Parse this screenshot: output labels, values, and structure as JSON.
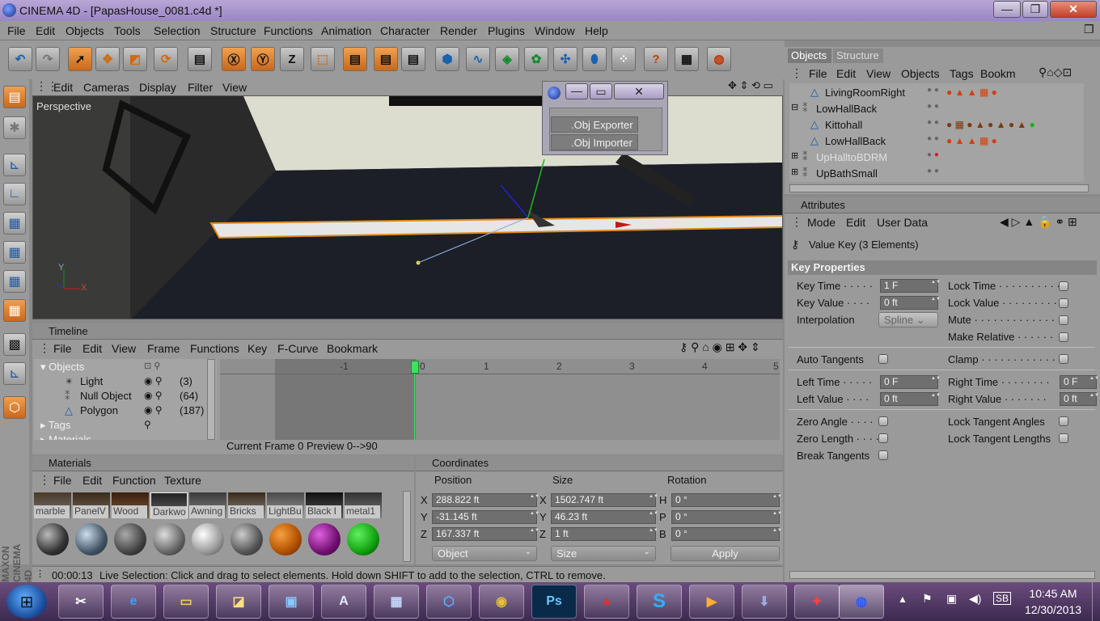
{
  "window": {
    "title": "CINEMA 4D - [PapasHouse_0081.c4d *]",
    "min": "—",
    "max": "❐",
    "close": "✕"
  },
  "menu": [
    "File",
    "Edit",
    "Objects",
    "Tools",
    "Selection",
    "Structure",
    "Functions",
    "Animation",
    "Character",
    "Render",
    "Plugins",
    "Window",
    "Help"
  ],
  "viewport": {
    "menu": [
      "Edit",
      "Cameras",
      "Display",
      "Filter",
      "View"
    ],
    "label": "Perspective",
    "axis_x": "X",
    "axis_y": "Y"
  },
  "popup": {
    "items": [
      ".Obj Exporter",
      ".Obj Importer"
    ]
  },
  "objects_panel": {
    "tabs": [
      "Objects",
      "Structure"
    ],
    "menu": [
      "File",
      "Edit",
      "View",
      "Objects",
      "Tags",
      "Bookm"
    ],
    "rows": [
      {
        "name": "LivingRoomRight"
      },
      {
        "name": "LowHallBack"
      },
      {
        "name": "Kittohall"
      },
      {
        "name": "LowHallBack"
      },
      {
        "name": "UpHalltoBDRM"
      },
      {
        "name": "UpBathSmall"
      }
    ]
  },
  "attributes": {
    "header": "Attributes",
    "menu": [
      "Mode",
      "Edit",
      "User Data"
    ],
    "title": "Value Key (3 Elements)",
    "section": "Key Properties",
    "key_time_label": "Key Time",
    "key_time": "1 F",
    "key_value_label": "Key Value",
    "key_value": "0 ft",
    "interpolation_label": "Interpolation",
    "interpolation": "Spline",
    "lock_time": "Lock Time",
    "lock_value": "Lock Value",
    "mute": "Mute",
    "make_relative": "Make Relative",
    "auto_tangents": "Auto Tangents",
    "clamp": "Clamp",
    "left_time_label": "Left Time",
    "left_time": "0 F",
    "left_value_label": "Left Value",
    "left_value": "0 ft",
    "right_time_label": "Right Time",
    "right_time": "0 F",
    "right_value_label": "Right Value",
    "right_value": "0 ft",
    "zero_angle": "Zero Angle",
    "zero_length": "Zero Length",
    "break_tangents": "Break Tangents",
    "lock_tangent_angles": "Lock Tangent Angles",
    "lock_tangent_lengths": "Lock Tangent Lengths"
  },
  "timeline": {
    "title": "Timeline",
    "menu": [
      "File",
      "Edit",
      "View",
      "Frame",
      "Functions",
      "Key",
      "F-Curve",
      "Bookmark"
    ],
    "tree": {
      "root": "Objects",
      "items": [
        {
          "name": "Light",
          "count": "(3)"
        },
        {
          "name": "Null Object",
          "count": "(64)"
        },
        {
          "name": "Polygon",
          "count": "(187)"
        }
      ],
      "tags": "Tags",
      "materials": "Materials"
    },
    "ruler": [
      "-1",
      "0",
      "1",
      "2",
      "3",
      "4",
      "5"
    ],
    "status": "Current Frame  0  Preview  0-->90"
  },
  "materials": {
    "title": "Materials",
    "menu": [
      "File",
      "Edit",
      "Function",
      "Texture"
    ],
    "row1": [
      "marble",
      "PanelV",
      "Wood",
      "Darkwo",
      "Awning",
      "Bricks",
      "LightBu",
      "Black I",
      "metal1"
    ]
  },
  "coordinates": {
    "title": "Coordinates",
    "headers": [
      "Position",
      "Size",
      "Rotation"
    ],
    "px": "288.822 ft",
    "py": "-31.145 ft",
    "pz": "167.337 ft",
    "sx": "1502.747 ft",
    "sy": "46.23 ft",
    "sz": "1 ft",
    "rh": "0 °",
    "rp": "0 °",
    "rb": "0 °",
    "mode": "Object",
    "size_mode": "Size",
    "apply": "Apply"
  },
  "status": {
    "time": "00:00:13",
    "message": "Live Selection: Click and drag to select elements. Hold down SHIFT to add to the selection, CTRL to remove."
  },
  "brand": "MAXON CINEMA 4D",
  "taskbar": {
    "time": "10:45 AM",
    "date": "12/30/2013",
    "ps": "Ps",
    "s": "S"
  }
}
